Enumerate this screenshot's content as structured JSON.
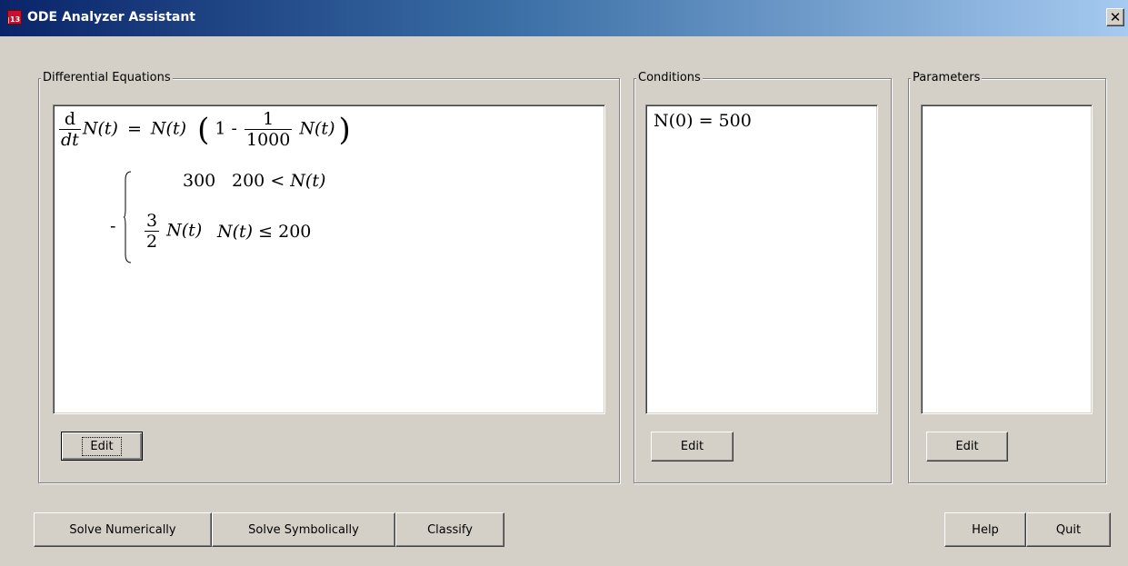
{
  "window": {
    "title": "ODE Analyzer Assistant",
    "close_glyph": "✕",
    "app_icon": "maple-13-icon"
  },
  "equations": {
    "legend": "Differential Equations",
    "lhs_d": "d",
    "lhs_dt": "dt",
    "N_t": "N(t)",
    "eq": "=",
    "one_minus": "1 -",
    "frac_num": "1",
    "frac_den": "1000",
    "minus": "-",
    "case1_value": "300",
    "case1_condition_lhs": "200",
    "case1_condition_op": "<",
    "case2_frac_num": "3",
    "case2_frac_den": "2",
    "case2_condition_op": "≤",
    "case2_condition_rhs": "200",
    "edit_label": "Edit"
  },
  "conditions": {
    "legend": "Conditions",
    "items": [
      "N(0) = 500"
    ],
    "edit_label": "Edit"
  },
  "parameters": {
    "legend": "Parameters",
    "items": [],
    "edit_label": "Edit"
  },
  "actions": {
    "solve_numerically": "Solve Numerically",
    "solve_symbolically": "Solve Symbolically",
    "classify": "Classify",
    "help": "Help",
    "quit": "Quit"
  }
}
